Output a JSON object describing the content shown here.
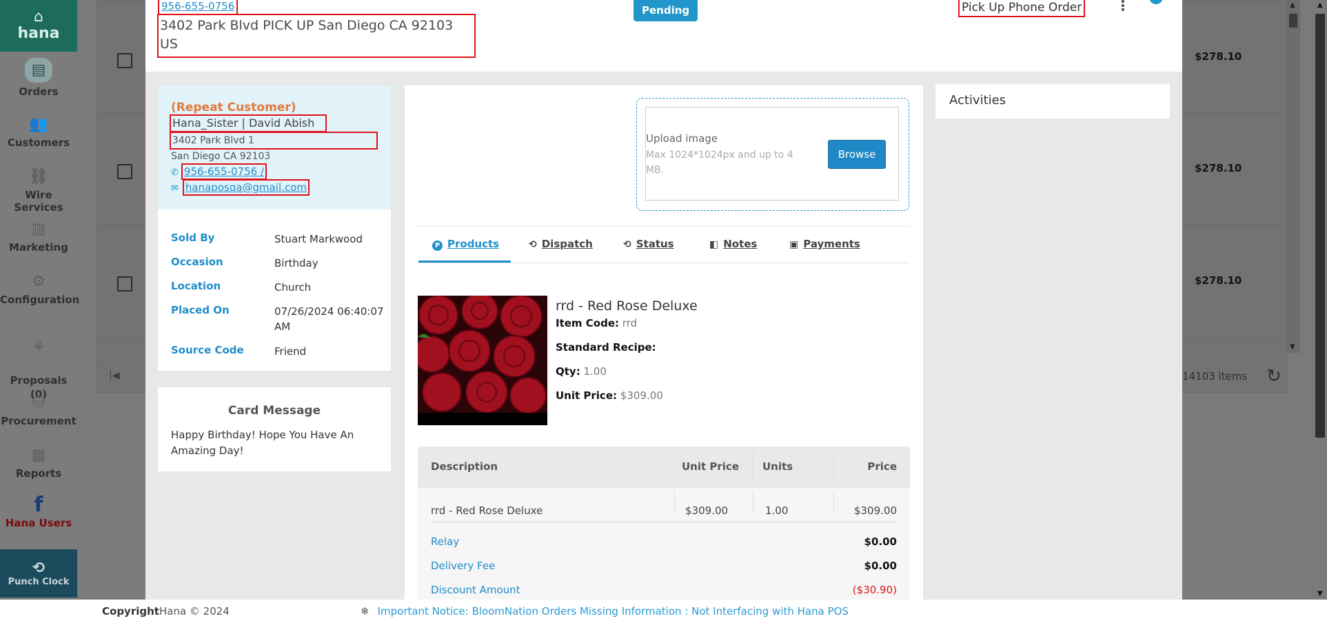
{
  "sidebar": {
    "brand": "hana",
    "items": [
      {
        "label": "Orders",
        "icon": "orders-icon"
      },
      {
        "label": "Customers",
        "icon": "customers-icon"
      },
      {
        "label": "Wire Services",
        "icon": "wire-services-icon"
      },
      {
        "label": "Marketing",
        "icon": "marketing-icon"
      },
      {
        "label": "Configuration",
        "icon": "gear-icon"
      },
      {
        "label": "Proposals\n(0)",
        "icon": "proposals-icon"
      },
      {
        "label": "Procurement",
        "icon": "procurement-icon"
      },
      {
        "label": "Reports",
        "icon": "reports-icon"
      },
      {
        "label": "Hana Users",
        "icon": "facebook-icon"
      }
    ],
    "punch_clock": "Punch Clock"
  },
  "background_list": {
    "prices": [
      "$278.10",
      "$278.10",
      "$278.10"
    ],
    "items_count": "14103 items"
  },
  "order": {
    "header_phone": "956-655-0756",
    "header_address": "3402 Park Blvd PICK UP San Diego CA 92103 US",
    "status": "Pending",
    "order_type": "Pick Up Phone Order"
  },
  "customer": {
    "repeat_label": "(Repeat Customer)",
    "name": "Hana_Sister | David Abish",
    "address1": "3402 Park Blvd 1",
    "address2": "San Diego CA 92103",
    "phone": "956-655-0756 /",
    "email": "hanaposqa@gmail.com"
  },
  "details": [
    {
      "label": "Sold By",
      "value": "Stuart Markwood"
    },
    {
      "label": "Occasion",
      "value": "Birthday"
    },
    {
      "label": "Location",
      "value": "Church"
    },
    {
      "label": "Placed On",
      "value": "07/26/2024 06:40:07 AM"
    },
    {
      "label": "Source Code",
      "value": "Friend"
    }
  ],
  "card": {
    "title": "Card Message",
    "message": "Happy Birthday! Hope You Have An Amazing Day!"
  },
  "upload": {
    "label": "Upload image",
    "hint": "Max 1024*1024px and up to 4 MB.",
    "browse": "Browse"
  },
  "tabs": [
    "Products",
    "Dispatch",
    "Status",
    "Notes",
    "Payments"
  ],
  "product": {
    "name": "rrd - Red Rose Deluxe",
    "item_code_label": "Item Code:",
    "item_code": "rrd",
    "recipe_label": "Standard Recipe:",
    "qty_label": "Qty:",
    "qty": "1.00",
    "unit_price_label": "Unit Price:",
    "unit_price": "$309.00"
  },
  "line_table": {
    "headers": [
      "Description",
      "Unit Price",
      "Units",
      "Price"
    ],
    "row": [
      "rrd - Red Rose Deluxe",
      "$309.00",
      "1.00",
      "$309.00"
    ],
    "summary": [
      {
        "label": "Relay",
        "value": "$0.00"
      },
      {
        "label": "Delivery Fee",
        "value": "$0.00"
      },
      {
        "label": "Discount Amount",
        "value": "($30.90)"
      }
    ]
  },
  "activities": {
    "title": "Activities"
  },
  "footer": {
    "copyright_label": "Copyright",
    "copyright_text": "Hana © 2024",
    "notice": "Important Notice: BloomNation Orders Missing Information : Not Interfacing with Hana POS"
  },
  "colors": {
    "accent": "#2196c9",
    "brand": "#1d6b5a",
    "highlight": "#e0121a",
    "repeat": "#e07a3f"
  }
}
